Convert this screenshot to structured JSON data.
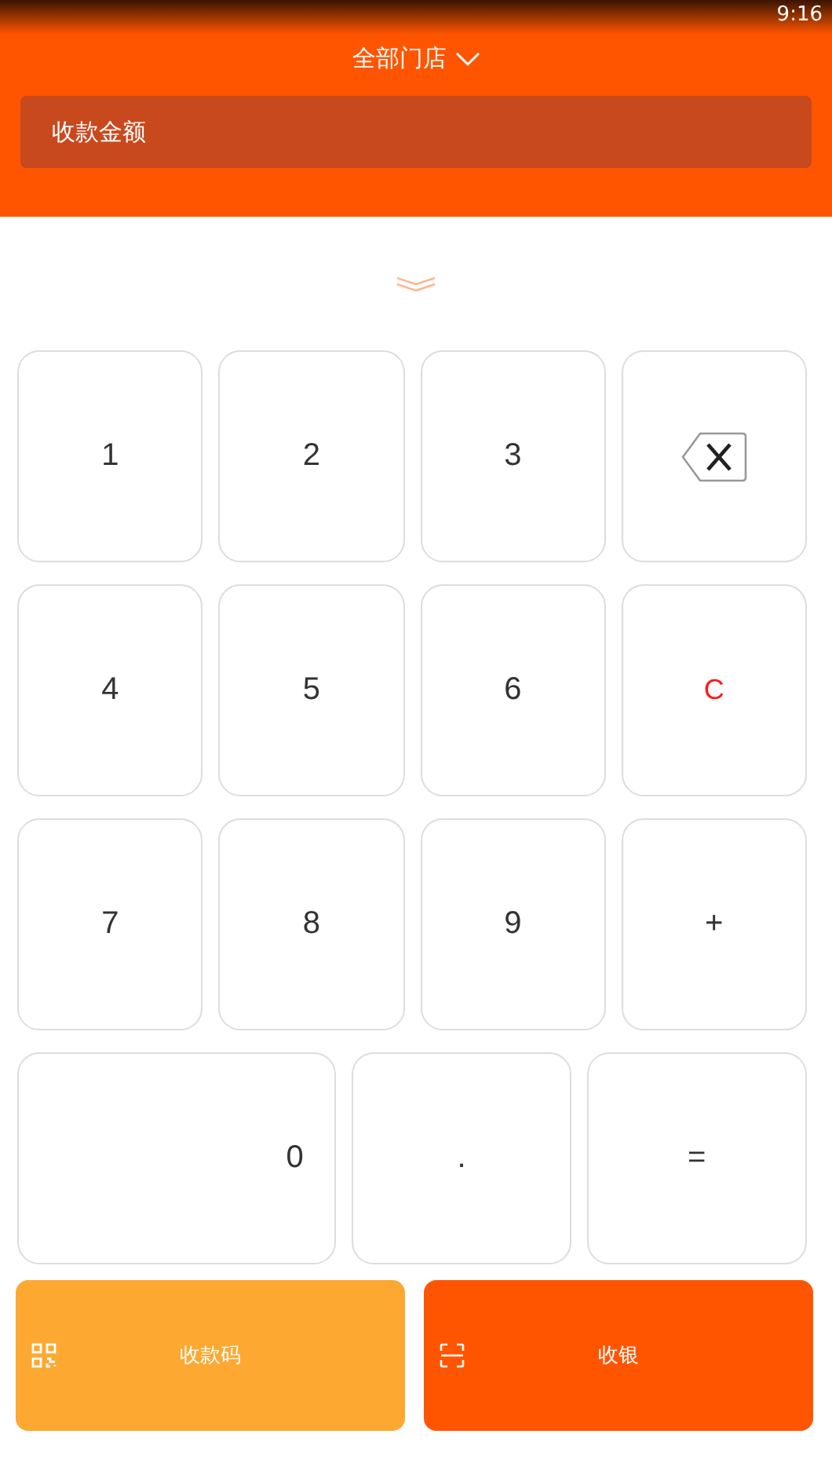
{
  "status_bar": {
    "time": "9:16"
  },
  "header": {
    "store_selector": "全部门店"
  },
  "amount_field": {
    "placeholder": "收款金额"
  },
  "keypad": {
    "rows": [
      [
        {
          "kind": "digit",
          "label": "1"
        },
        {
          "kind": "digit",
          "label": "2"
        },
        {
          "kind": "digit",
          "label": "3"
        },
        {
          "kind": "backspace"
        }
      ],
      [
        {
          "kind": "digit",
          "label": "4"
        },
        {
          "kind": "digit",
          "label": "5"
        },
        {
          "kind": "digit",
          "label": "6"
        },
        {
          "kind": "clear",
          "label": "C"
        }
      ],
      [
        {
          "kind": "digit",
          "label": "7"
        },
        {
          "kind": "digit",
          "label": "8"
        },
        {
          "kind": "digit",
          "label": "9"
        },
        {
          "kind": "op",
          "label": "+"
        }
      ],
      [
        {
          "kind": "zero",
          "label": "0"
        },
        {
          "kind": "digit",
          "label": "."
        },
        {
          "kind": "op",
          "label": "="
        }
      ]
    ]
  },
  "actions": [
    {
      "kind": "qr",
      "label": "收款码",
      "color": "#fda831"
    },
    {
      "kind": "scan",
      "label": "收银",
      "color": "#ff5500"
    }
  ]
}
